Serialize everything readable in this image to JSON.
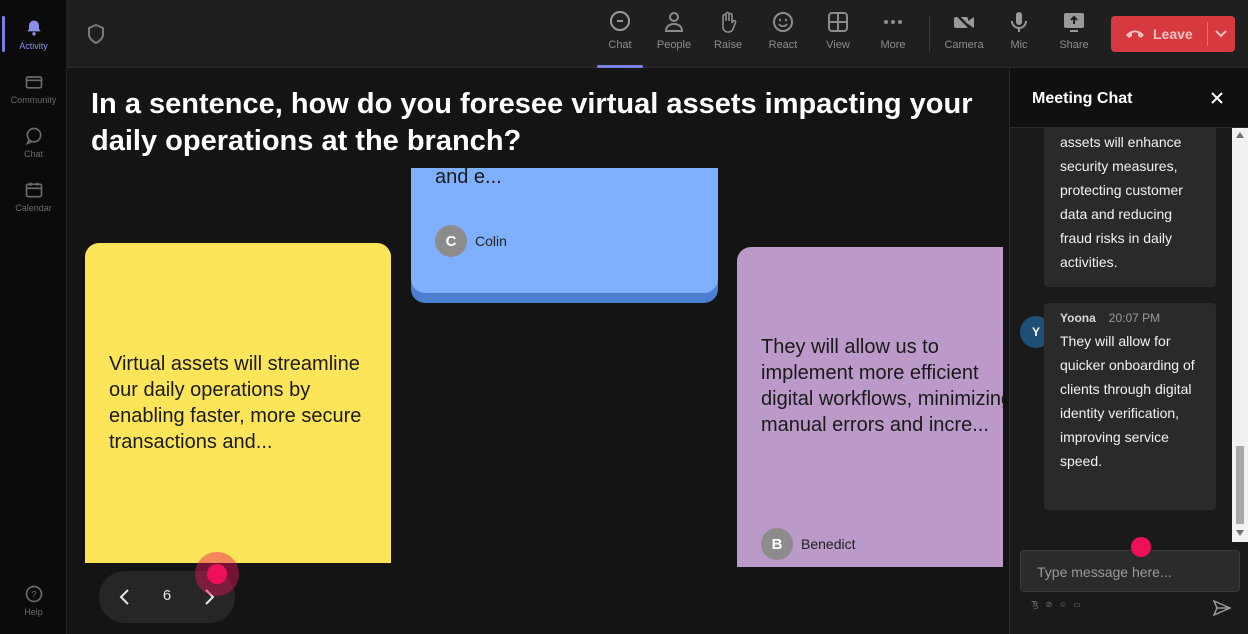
{
  "rail": {
    "items": [
      {
        "label": "Activity",
        "icon": "bell-icon",
        "active": true
      },
      {
        "label": "Community",
        "icon": "community-icon"
      },
      {
        "label": "Chat",
        "icon": "chat-icon"
      },
      {
        "label": "Calendar",
        "icon": "calendar-icon"
      }
    ],
    "help": {
      "label": "Help",
      "icon": "help-icon"
    }
  },
  "toolbar": {
    "tools": [
      {
        "label": "Chat",
        "icon": "chat-icon",
        "active": true
      },
      {
        "label": "People",
        "icon": "people-icon"
      },
      {
        "label": "Raise",
        "icon": "raise-hand-icon"
      },
      {
        "label": "React",
        "icon": "react-icon"
      },
      {
        "label": "View",
        "icon": "view-grid-icon"
      },
      {
        "label": "More",
        "icon": "more-icon"
      },
      {
        "label": "Camera",
        "icon": "camera-off-icon"
      },
      {
        "label": "Mic",
        "icon": "mic-icon"
      },
      {
        "label": "Share",
        "icon": "share-icon"
      }
    ],
    "leave_label": "Leave",
    "leave_color": "#d63a3f"
  },
  "stage": {
    "question": "In a sentence, how do you foresee virtual assets impacting your daily operations at the branch?",
    "cards": {
      "yellow": {
        "text": "Virtual assets will streamline our daily operations by enabling faster, more secure transactions and...",
        "color": "#fde55a"
      },
      "blue": {
        "text": "and e...",
        "author_initial": "C",
        "author_name": "Colin",
        "color": "#7fb0ff"
      },
      "purple": {
        "text": "They will allow us to implement more efficient digital workflows, minimizing manual errors and incre...",
        "author_initial": "B",
        "author_name": "Benedict",
        "color": "#bb99c9"
      }
    },
    "pager": {
      "page": "6"
    }
  },
  "chat": {
    "title": "Meeting Chat",
    "messages": [
      {
        "text": "assets will enhance security measures, protecting customer data and reducing fraud risks in daily activities."
      },
      {
        "avatar": "Y",
        "name": "Yoona",
        "time": "20:07 PM",
        "text": "They will allow for quicker onboarding of clients through digital identity verification, improving service speed."
      }
    ],
    "input_placeholder": "Type message here..."
  }
}
